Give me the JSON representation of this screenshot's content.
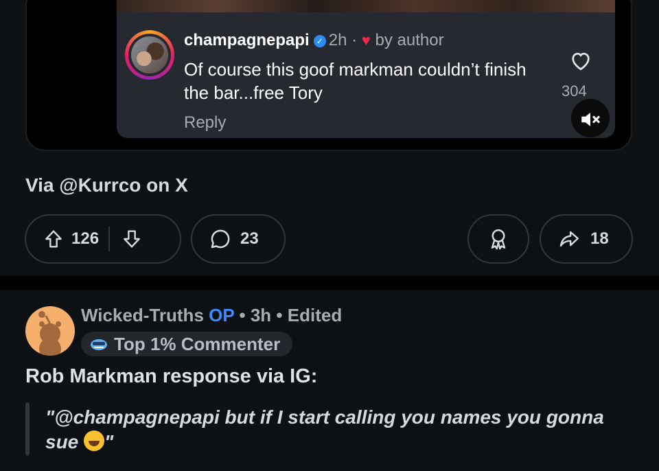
{
  "ig_comment": {
    "username": "champagnepapi",
    "time": "2h",
    "separator": "·",
    "liked_by": "by author",
    "text": "Of course this goof markman couldn’t finish the bar...free Tory",
    "reply_label": "Reply",
    "like_count": "304"
  },
  "post": {
    "caption": "Via @Kurrco on X",
    "upvotes": "126",
    "comments": "23",
    "shares": "18"
  },
  "comment": {
    "author": "Wicked-Truths",
    "op_badge": "OP",
    "time": "3h",
    "edited": "Edited",
    "bullet": "•",
    "flair": "Top 1% Commenter",
    "body": "Rob Markman response via IG:",
    "quote": "\"@champagnepapi but if I start calling you names you gonna sue",
    "quote_end": "\""
  },
  "colors": {
    "background": "#0e1113",
    "op_blue": "#3d8bff",
    "heart_red": "#f0284a",
    "pill_border": "#343536"
  }
}
